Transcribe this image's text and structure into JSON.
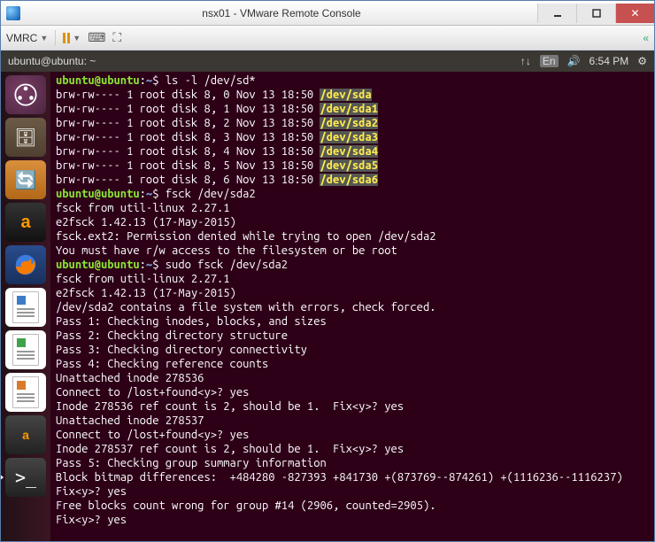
{
  "window": {
    "title": "nsx01 - VMware Remote Console"
  },
  "toolbar": {
    "vmrc": "VMRC"
  },
  "menubar": {
    "title": "ubuntu@ubuntu: ~",
    "lang": "En",
    "time": "6:54 PM"
  },
  "prompt": {
    "user": "ubuntu@ubuntu",
    "sep": ":",
    "path": "~",
    "dollar": "$ "
  },
  "cmd": {
    "ls": "ls -l /dev/sd*",
    "fsck": "fsck /dev/sda2",
    "sudo_fsck": "sudo fsck /dev/sda2"
  },
  "ls_rows": [
    {
      "perm": "brw-rw---- 1 root disk 8, 0 Nov 13 18:50",
      "dev": "/dev/sda"
    },
    {
      "perm": "brw-rw---- 1 root disk 8, 1 Nov 13 18:50",
      "dev": "/dev/sda1"
    },
    {
      "perm": "brw-rw---- 1 root disk 8, 2 Nov 13 18:50",
      "dev": "/dev/sda2"
    },
    {
      "perm": "brw-rw---- 1 root disk 8, 3 Nov 13 18:50",
      "dev": "/dev/sda3"
    },
    {
      "perm": "brw-rw---- 1 root disk 8, 4 Nov 13 18:50",
      "dev": "/dev/sda4"
    },
    {
      "perm": "brw-rw---- 1 root disk 8, 5 Nov 13 18:50",
      "dev": "/dev/sda5"
    },
    {
      "perm": "brw-rw---- 1 root disk 8, 6 Nov 13 18:50",
      "dev": "/dev/sda6"
    }
  ],
  "out": {
    "fsck_from": "fsck from util-linux 2.27.1",
    "e2fsck_ver": "e2fsck 1.42.13 (17-May-2015)",
    "perm_denied": "fsck.ext2: Permission denied while trying to open /dev/sda2",
    "must_rw": "You must have r/w access to the filesystem or be root",
    "contains": "/dev/sda2 contains a file system with errors, check forced.",
    "pass1": "Pass 1: Checking inodes, blocks, and sizes",
    "pass2": "Pass 2: Checking directory structure",
    "pass3": "Pass 3: Checking directory connectivity",
    "pass4": "Pass 4: Checking reference counts",
    "un1": "Unattached inode 278536",
    "con1": "Connect to /lost+found<y>? yes",
    "ref1": "Inode 278536 ref count is 2, should be 1.  Fix<y>? yes",
    "un2": "Unattached inode 278537",
    "con2": "Connect to /lost+found<y>? yes",
    "ref2": "Inode 278537 ref count is 2, should be 1.  Fix<y>? yes",
    "pass5": "Pass 5: Checking group summary information",
    "bitmap": "Block bitmap differences:  +484280 -827393 +841730 +(873769--874261) +(1116236--1116237)",
    "fix1": "Fix<y>? yes",
    "freeblk": "Free blocks count wrong for group #14 (2906, counted=2905).",
    "fix2": "Fix<y>? yes"
  }
}
